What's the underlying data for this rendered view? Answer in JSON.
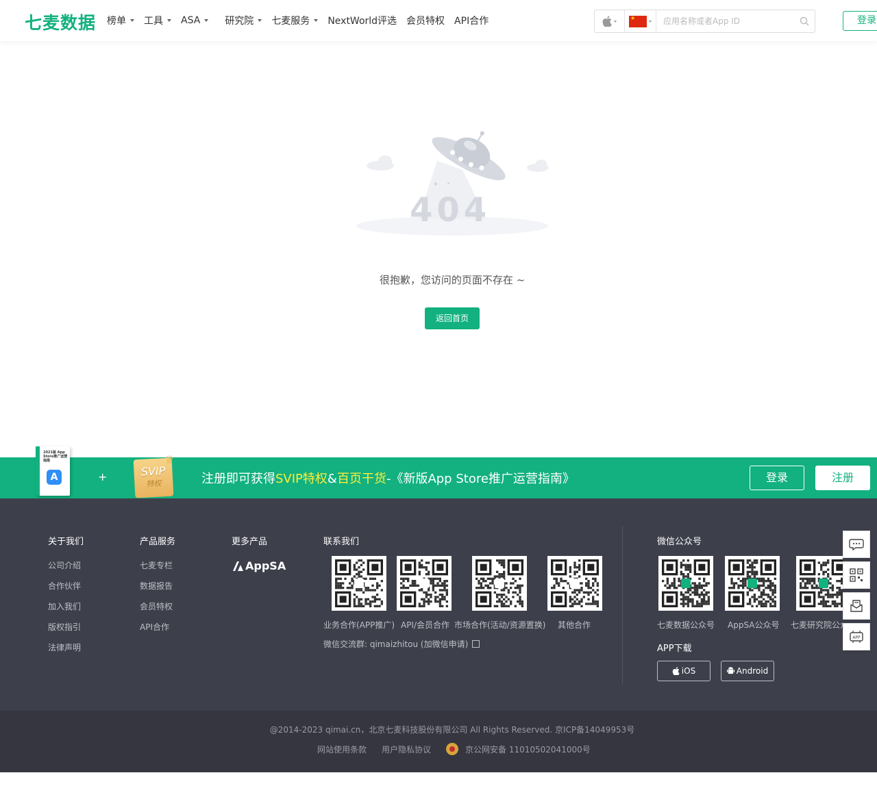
{
  "header": {
    "logo": "七麦数据",
    "nav": [
      {
        "label": "榜单",
        "dropdown": true
      },
      {
        "label": "工具",
        "dropdown": true
      },
      {
        "label": "ASA",
        "dropdown": true
      },
      {
        "label": "研究院",
        "dropdown": true
      },
      {
        "label": "七麦服务",
        "dropdown": true
      },
      {
        "label": "NextWorld评选",
        "dropdown": false
      },
      {
        "label": "会员特权",
        "dropdown": false
      },
      {
        "label": "API合作",
        "dropdown": false
      }
    ],
    "search_placeholder": "应用名称或者App ID",
    "login": "登录"
  },
  "main": {
    "error_code": "404",
    "message": "很抱歉，您访问的页面不存在 ~",
    "home_button": "返回首页"
  },
  "promo": {
    "book_title": "2021版 App Store推广运营指南",
    "plus": "+",
    "svip": "SVIP",
    "svip_sub": "特权",
    "text_a": "注册即可获得",
    "text_hl1": "SVIP特权",
    "text_b": "&",
    "text_hl2": "百页干货",
    "text_c": "-《新版App Store推广运营指南》",
    "login": "登录",
    "register": "注册"
  },
  "footer": {
    "about": {
      "title": "关于我们",
      "links": [
        "公司介绍",
        "合作伙伴",
        "加入我们",
        "版权指引",
        "法律声明"
      ]
    },
    "products": {
      "title": "产品服务",
      "links": [
        "七麦专栏",
        "数据报告",
        "会员特权",
        "API合作"
      ]
    },
    "more": {
      "title": "更多产品",
      "appsa": "AppSA"
    },
    "contact": {
      "title": "联系我们",
      "qr_labels": [
        "业务合作(APP推广)",
        "API/会员合作",
        "市场合作(活动/资源置换)",
        "其他合作"
      ],
      "wechat_group": "微信交流群: qimaizhitou (加微信申请)"
    },
    "wechat": {
      "title": "微信公众号",
      "qr_labels": [
        "七麦数据公众号",
        "AppSA公众号",
        "七麦研究院公众号"
      ]
    },
    "app_download": {
      "title": "APP下载",
      "ios": "iOS",
      "android": "Android"
    },
    "copyright": "@2014-2023 qimai.cn，北京七麦科技股份有限公司 All Rights Reserved. 京ICP备14049953号",
    "legal": [
      "网站使用条款",
      "用户隐私协议"
    ],
    "police": "京公网安备 11010502041000号"
  },
  "colors": {
    "brand": "#12b17f",
    "footer_bg": "#3d3f4b",
    "highlight": "#ffee3b"
  },
  "side_tools": [
    "chat-icon",
    "qrcode-icon",
    "message-icon",
    "api-icon"
  ]
}
